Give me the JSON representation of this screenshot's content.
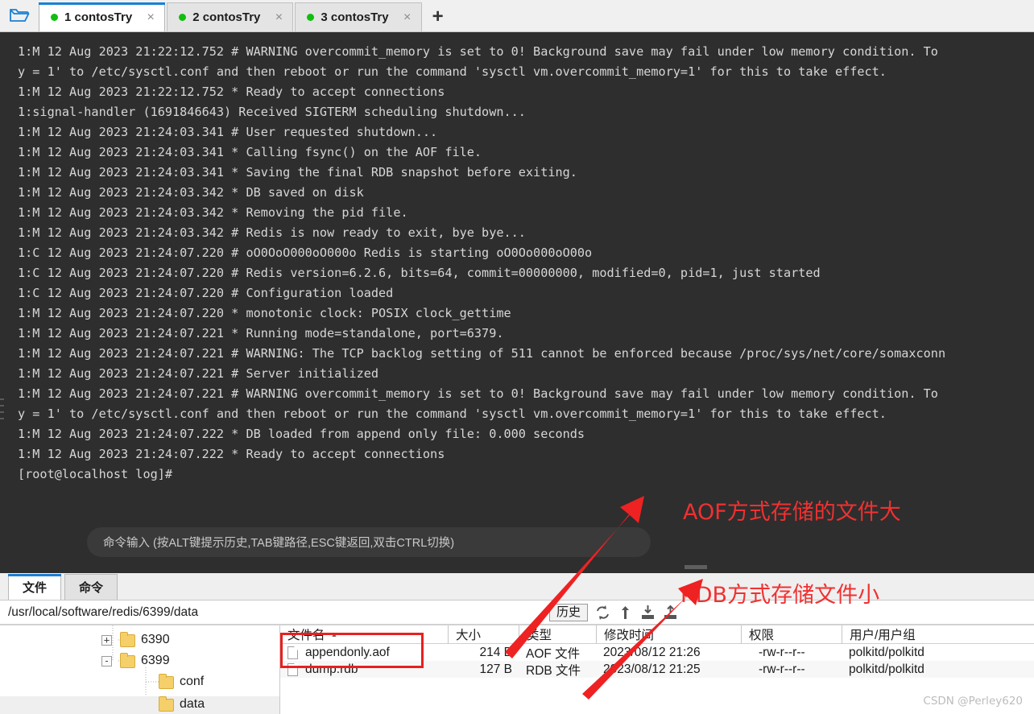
{
  "window": {
    "folder_icon": "open-folder-icon",
    "add_tab_label": "+",
    "tabs": [
      {
        "label": "1 contosTry",
        "close": "×",
        "status": "connected"
      },
      {
        "label": "2 contosTry",
        "close": "×",
        "status": "connected"
      },
      {
        "label": "3 contosTry",
        "close": "×",
        "status": "connected"
      }
    ]
  },
  "terminal": {
    "lines": [
      "1:M 12 Aug 2023 21:22:12.752 # WARNING overcommit_memory is set to 0! Background save may fail under low memory condition. To",
      "y = 1' to /etc/sysctl.conf and then reboot or run the command 'sysctl vm.overcommit_memory=1' for this to take effect.",
      "1:M 12 Aug 2023 21:22:12.752 * Ready to accept connections",
      "1:signal-handler (1691846643) Received SIGTERM scheduling shutdown...",
      "1:M 12 Aug 2023 21:24:03.341 # User requested shutdown...",
      "1:M 12 Aug 2023 21:24:03.341 * Calling fsync() on the AOF file.",
      "1:M 12 Aug 2023 21:24:03.341 * Saving the final RDB snapshot before exiting.",
      "1:M 12 Aug 2023 21:24:03.342 * DB saved on disk",
      "1:M 12 Aug 2023 21:24:03.342 * Removing the pid file.",
      "1:M 12 Aug 2023 21:24:03.342 # Redis is now ready to exit, bye bye...",
      "1:C 12 Aug 2023 21:24:07.220 # oO0OoO000oO000o Redis is starting oO0Oo000oO00o",
      "1:C 12 Aug 2023 21:24:07.220 # Redis version=6.2.6, bits=64, commit=00000000, modified=0, pid=1, just started",
      "1:C 12 Aug 2023 21:24:07.220 # Configuration loaded",
      "1:M 12 Aug 2023 21:24:07.220 * monotonic clock: POSIX clock_gettime",
      "1:M 12 Aug 2023 21:24:07.221 * Running mode=standalone, port=6379.",
      "1:M 12 Aug 2023 21:24:07.221 # WARNING: The TCP backlog setting of 511 cannot be enforced because /proc/sys/net/core/somaxconn",
      "1:M 12 Aug 2023 21:24:07.221 # Server initialized",
      "1:M 12 Aug 2023 21:24:07.221 # WARNING overcommit_memory is set to 0! Background save may fail under low memory condition. To",
      "y = 1' to /etc/sysctl.conf and then reboot or run the command 'sysctl vm.overcommit_memory=1' for this to take effect.",
      "1:M 12 Aug 2023 21:24:07.222 * DB loaded from append only file: 0.000 seconds",
      "1:M 12 Aug 2023 21:24:07.222 * Ready to accept connections",
      "[root@localhost log]#"
    ],
    "command_hint": "命令输入 (按ALT键提示历史,TAB键路径,ESC键返回,双击CTRL切换)"
  },
  "annotations": {
    "aof_note": "AOF方式存储的文件大",
    "rdb_note": "RDB方式存储文件小",
    "color": "#f23030"
  },
  "bottom_panel": {
    "tabs": [
      {
        "label": "文件",
        "active": true
      },
      {
        "label": "命令",
        "active": false
      }
    ],
    "path": "/usr/local/software/redis/6399/data",
    "toolbar": {
      "history_label": "历史",
      "icons": [
        "refresh-icon",
        "upload-arrow-icon",
        "download-icon",
        "upload-icon"
      ]
    },
    "tree": [
      {
        "label": "6390",
        "expander": "+",
        "depth": 1
      },
      {
        "label": "6399",
        "expander": "-",
        "depth": 1
      },
      {
        "label": "conf",
        "expander": "",
        "depth": 2
      },
      {
        "label": "data",
        "expander": "",
        "depth": 2
      }
    ],
    "file_list": {
      "columns": [
        "文件名",
        "大小",
        "类型",
        "修改时间",
        "权限",
        "用户/用户组"
      ],
      "sort_column": "文件名",
      "sort_caret": "▲",
      "rows": [
        {
          "name": "appendonly.aof",
          "size": "214 B",
          "type": "AOF 文件",
          "modified": "2023/08/12 21:26",
          "permissions": "-rw-r--r--",
          "owner": "polkitd/polkitd"
        },
        {
          "name": "dump.rdb",
          "size": "127 B",
          "type": "RDB 文件",
          "modified": "2023/08/12 21:25",
          "permissions": "-rw-r--r--",
          "owner": "polkitd/polkitd"
        }
      ]
    }
  },
  "watermark": "CSDN @Perley620"
}
